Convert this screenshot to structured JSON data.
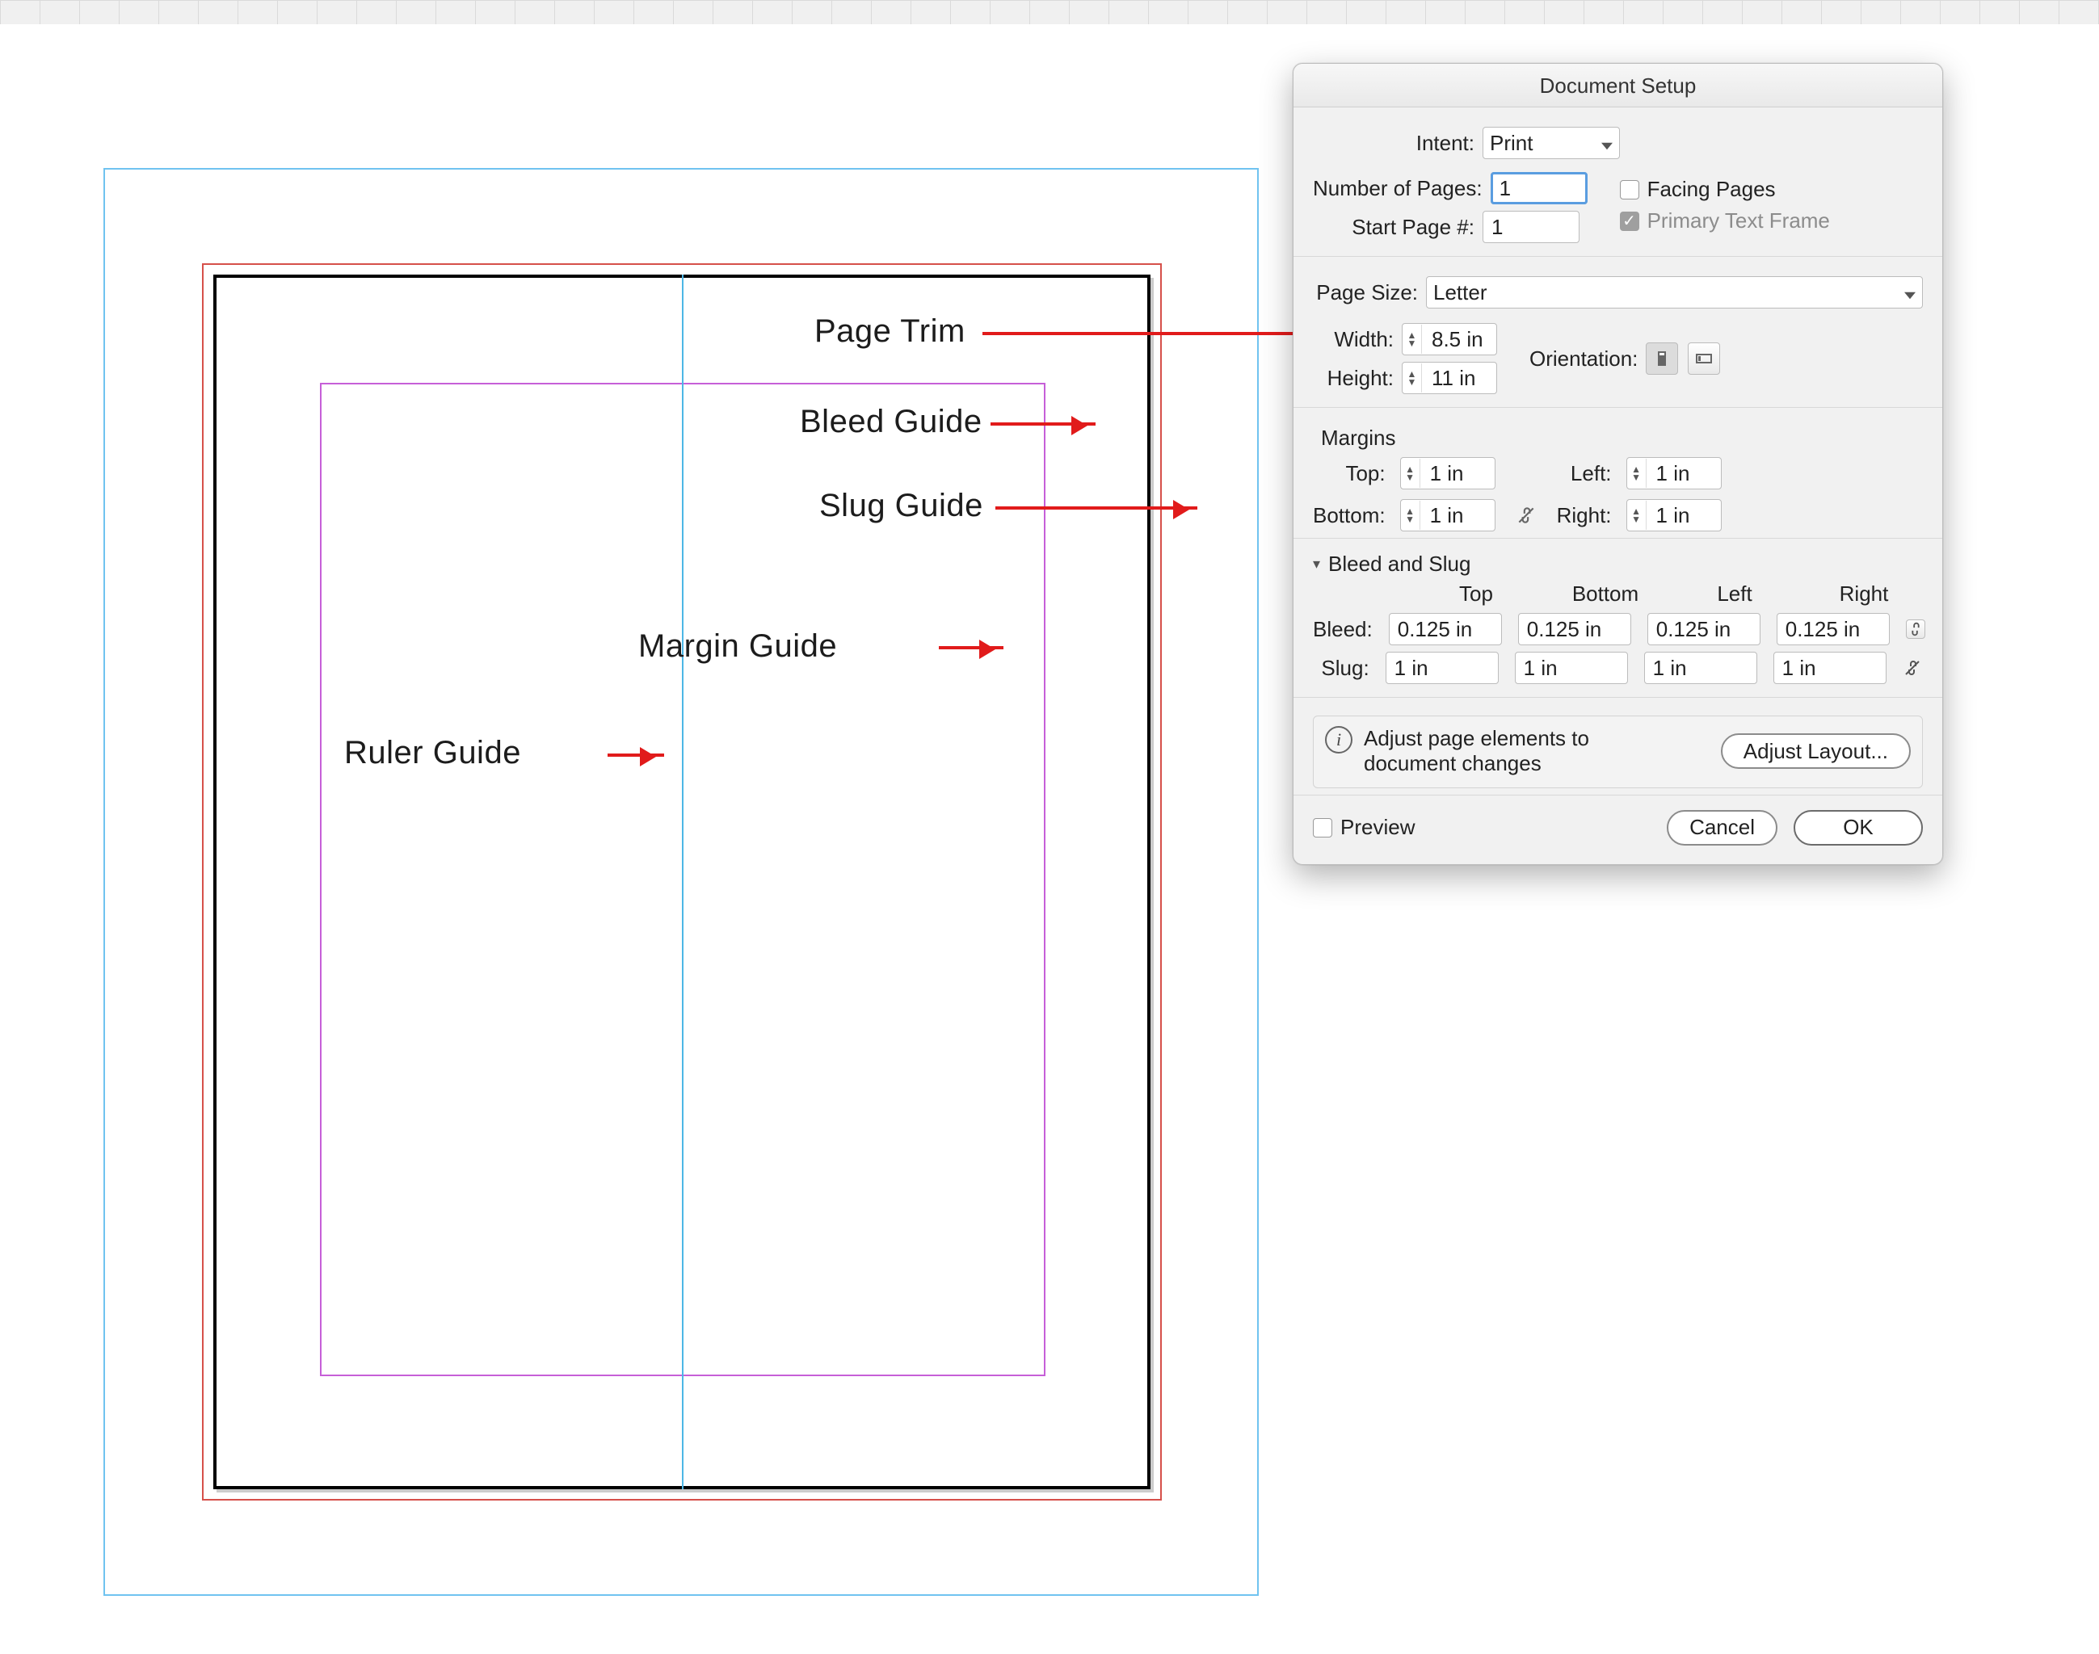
{
  "dialog": {
    "title": "Document Setup",
    "intent_label": "Intent:",
    "intent_value": "Print",
    "num_pages_label": "Number of Pages:",
    "num_pages_value": "1",
    "start_page_label": "Start Page #:",
    "start_page_value": "1",
    "facing_pages_label": "Facing Pages",
    "facing_pages_checked": false,
    "primary_frame_label": "Primary Text Frame",
    "primary_frame_checked": true,
    "primary_frame_disabled": true,
    "page_size_label": "Page Size:",
    "page_size_value": "Letter",
    "width_label": "Width:",
    "width_value": "8.5 in",
    "height_label": "Height:",
    "height_value": "11 in",
    "orientation_label": "Orientation:",
    "margins_title": "Margins",
    "margins": {
      "top_label": "Top:",
      "top": "1 in",
      "bottom_label": "Bottom:",
      "bottom": "1 in",
      "left_label": "Left:",
      "left": "1 in",
      "right_label": "Right:",
      "right": "1 in"
    },
    "bleed_slug_title": "Bleed and Slug",
    "col_top": "Top",
    "col_bottom": "Bottom",
    "col_left": "Left",
    "col_right": "Right",
    "bleed_label": "Bleed:",
    "bleed": {
      "top": "0.125 in",
      "bottom": "0.125 in",
      "left": "0.125 in",
      "right": "0.125 in"
    },
    "slug_label": "Slug:",
    "slug": {
      "top": "1 in",
      "bottom": "1 in",
      "left": "1 in",
      "right": "1 in"
    },
    "adjust_text": "Adjust page elements to document changes",
    "adjust_button": "Adjust Layout...",
    "preview_label": "Preview",
    "preview_checked": false,
    "cancel": "Cancel",
    "ok": "OK"
  },
  "annotations": {
    "page_trim": "Page Trim",
    "bleed_guide": "Bleed Guide",
    "slug_guide": "Slug Guide",
    "margin_guide": "Margin Guide",
    "ruler_guide": "Ruler  Guide"
  }
}
